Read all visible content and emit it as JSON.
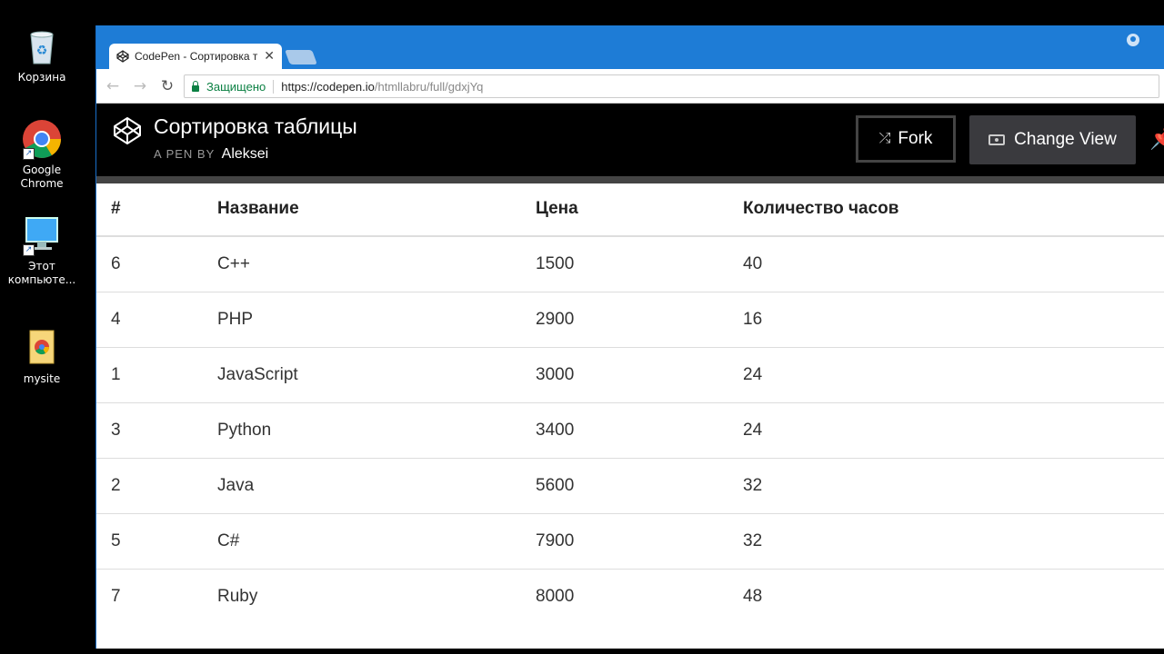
{
  "desktop": {
    "icons": [
      {
        "label": "Корзина",
        "icon": "recycle-bin-icon"
      },
      {
        "label": "Google Chrome",
        "icon": "chrome-icon"
      },
      {
        "label": "Этот компьюте...",
        "icon": "computer-icon"
      },
      {
        "label": "mysite",
        "icon": "chrome-folder-icon"
      }
    ]
  },
  "browser": {
    "tab_title": "CodePen - Сортировка т",
    "secure_label": "Защищено",
    "url_host": "https://codepen.io",
    "url_path": "/htmllabru/full/gdxjYq"
  },
  "codepen": {
    "title": "Сортировка таблицы",
    "byline_prefix": "A PEN BY",
    "author": "Aleksei",
    "fork_label": "Fork",
    "change_view_label": "Change View"
  },
  "table": {
    "headers": [
      "#",
      "Название",
      "Цена",
      "Количество часов"
    ],
    "rows": [
      [
        "6",
        "C++",
        "1500",
        "40"
      ],
      [
        "4",
        "PHP",
        "2900",
        "16"
      ],
      [
        "1",
        "JavaScript",
        "3000",
        "24"
      ],
      [
        "3",
        "Python",
        "3400",
        "24"
      ],
      [
        "2",
        "Java",
        "5600",
        "32"
      ],
      [
        "5",
        "C#",
        "7900",
        "32"
      ],
      [
        "7",
        "Ruby",
        "8000",
        "48"
      ]
    ]
  },
  "colors": {
    "titlebar": "#1e7cd6",
    "secure_green": "#0b8043",
    "codepen_header": "#000000"
  }
}
